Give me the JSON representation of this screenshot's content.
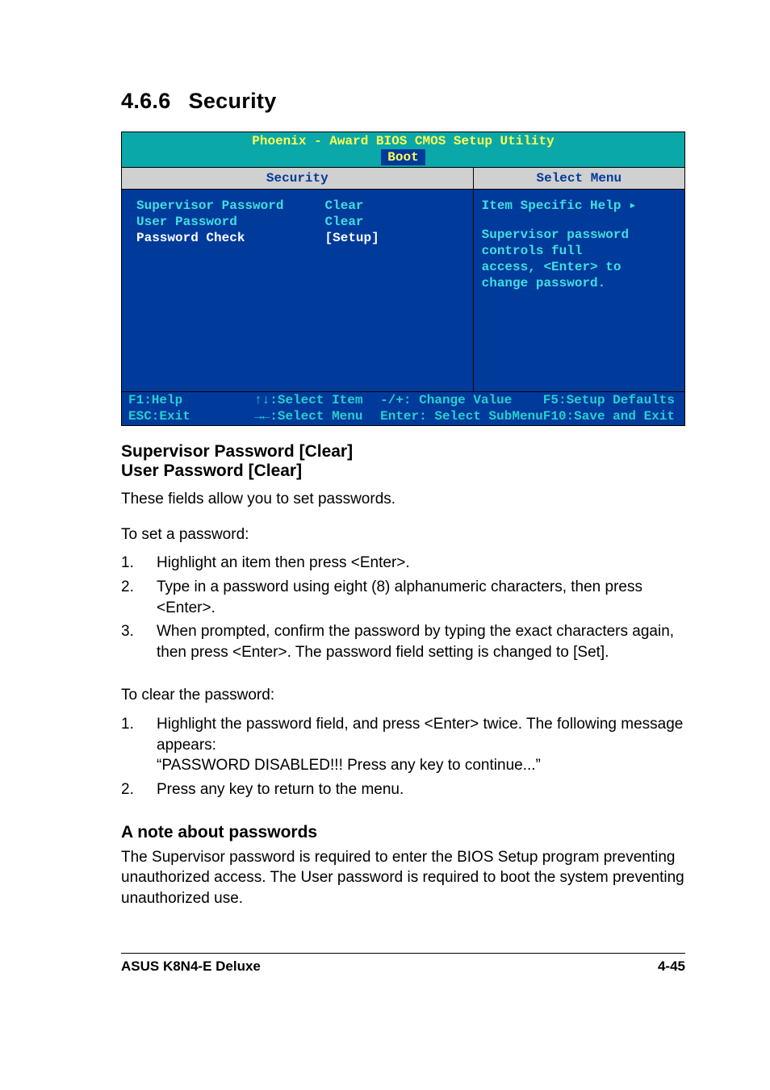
{
  "heading": {
    "number": "4.6.6",
    "title": "Security"
  },
  "bios": {
    "utility_title": "Phoenix - Award BIOS CMOS Setup Utility",
    "active_tab": "Boot",
    "left_header": "Security",
    "right_header": "Select Menu",
    "items": [
      {
        "label": "Supervisor Password",
        "value": "Clear"
      },
      {
        "label": "User Password",
        "value": "Clear"
      },
      {
        "label": "Password Check",
        "value": "[Setup]"
      }
    ],
    "help": {
      "title": "Item Specific Help",
      "arrow": "▸",
      "lines": [
        "Supervisor password",
        "controls full",
        "access, <Enter> to",
        "change password."
      ]
    },
    "footer": {
      "col1_line1": "F1:Help",
      "col1_line2": "ESC:Exit",
      "col2_line1": "↑↓:Select Item",
      "col2_line2": "→←:Select Menu",
      "col3_line1": "-/+: Change Value",
      "col3_line2": "Enter: Select SubMenu",
      "col4_line1": "F5:Setup Defaults",
      "col4_line2": "F10:Save and Exit"
    }
  },
  "sections": {
    "subhead_line1": "Supervisor Password [Clear]",
    "subhead_line2": "User Password [Clear]",
    "desc": "These fields allow you to set passwords.",
    "toset_lead": "To set a password:",
    "toset_steps": [
      "Highlight an item then press <Enter>.",
      "Type in a password using eight (8) alphanumeric characters, then press <Enter>.",
      "When prompted, confirm the password by typing the exact characters again, then press <Enter>.  The password field setting is changed to [Set]."
    ],
    "toclear_lead": "To clear the password:",
    "toclear_step1_line1": "Highlight the password field, and press <Enter> twice. The following message appears:",
    "toclear_step1_line2": "“PASSWORD DISABLED!!! Press any key to continue...”",
    "toclear_step2": "Press any key to return to the menu.",
    "note_head": "A note about passwords",
    "note_body": "The Supervisor password is required to enter the BIOS Setup program preventing unauthorized access. The User password is required to boot the system preventing unauthorized use."
  },
  "footer": {
    "left": "ASUS K8N4-E Deluxe",
    "right": "4-45"
  }
}
